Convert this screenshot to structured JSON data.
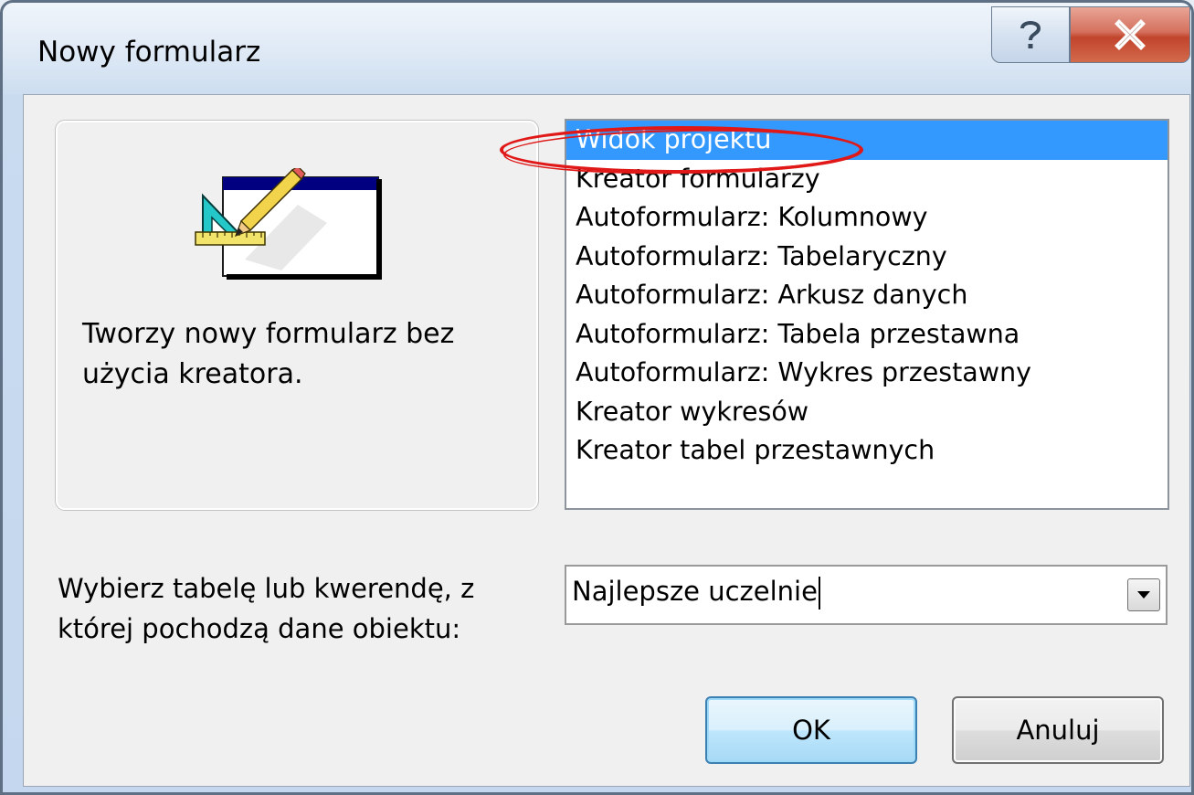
{
  "window": {
    "title": "Nowy formularz",
    "help_glyph": "?",
    "close_glyph": "x"
  },
  "preview": {
    "icon": "form-design-icon",
    "description": "Tworzy nowy formularz bez użycia kreatora."
  },
  "list": {
    "selected_index": 0,
    "items": [
      "Widok projektu",
      "Kreator formularzy",
      "Autoformularz:  Kolumnowy",
      "Autoformularz:  Tabelaryczny",
      "Autoformularz:  Arkusz danych",
      "Autoformularz: Tabela przestawna",
      "Autoformularz: Wykres przestawny",
      "Kreator wykresów",
      "Kreator tabel przestawnych"
    ]
  },
  "source": {
    "label": "Wybierz tabelę lub kwerendę, z której pochodzą dane obiektu:",
    "value": "Najlepsze uczelnie"
  },
  "buttons": {
    "ok": "OK",
    "cancel": "Anuluj"
  },
  "colors": {
    "selection": "#3399ff",
    "highlight_ellipse": "#e01818"
  }
}
